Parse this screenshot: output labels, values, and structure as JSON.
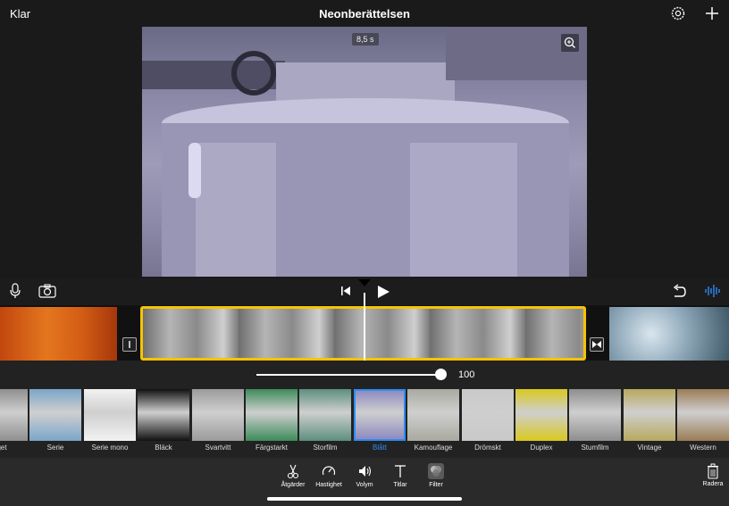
{
  "topbar": {
    "done_label": "Klar",
    "title": "Neonberättelsen",
    "settings_icon": "gear-icon",
    "add_icon": "plus-icon"
  },
  "viewer": {
    "duration": "8,5 s",
    "zoom_icon": "magnifier-plus-icon"
  },
  "transport": {
    "mic_icon": "microphone-icon",
    "camera_icon": "camera-icon",
    "skip_icon": "skip-back-icon",
    "play_icon": "play-icon",
    "undo_icon": "undo-icon",
    "audio_icon": "waveform-icon"
  },
  "slider": {
    "value": "100",
    "level": 1.0
  },
  "filters": [
    {
      "label": "get",
      "tint": "#8f8f8f"
    },
    {
      "label": "Serie",
      "tint": "#7aa6c9"
    },
    {
      "label": "Serie mono",
      "tint": "#f2f2f2"
    },
    {
      "label": "Bläck",
      "tint": "#111111"
    },
    {
      "label": "Svartvitt",
      "tint": "#9b9b9b"
    },
    {
      "label": "Färgstarkt",
      "tint": "#3d8b5a"
    },
    {
      "label": "Storfilm",
      "tint": "#5c8f7e"
    },
    {
      "label": "Blått",
      "tint": "#8a86bf",
      "selected": true
    },
    {
      "label": "Kamouflage",
      "tint": "#a9a9a0"
    },
    {
      "label": "Drömskt",
      "tint": "#c9c9c9"
    },
    {
      "label": "Duplex",
      "tint": "#d9c91f"
    },
    {
      "label": "Stumfilm",
      "tint": "#8e8e8e"
    },
    {
      "label": "Vintage",
      "tint": "#b8a85e"
    },
    {
      "label": "Western",
      "tint": "#9a7c55"
    }
  ],
  "toolbar": {
    "items": [
      {
        "label": "Åtgärder",
        "icon": "scissors-icon"
      },
      {
        "label": "Hastighet",
        "icon": "speedometer-icon"
      },
      {
        "label": "Volym",
        "icon": "speaker-icon"
      },
      {
        "label": "Titlar",
        "icon": "text-t-icon"
      },
      {
        "label": "Filter",
        "icon": "filter-circles-icon"
      }
    ],
    "delete_label": "Radera",
    "delete_icon": "trash-icon"
  },
  "colors": {
    "accent": "#2c8cf5",
    "clip_selection": "#f5c400"
  }
}
